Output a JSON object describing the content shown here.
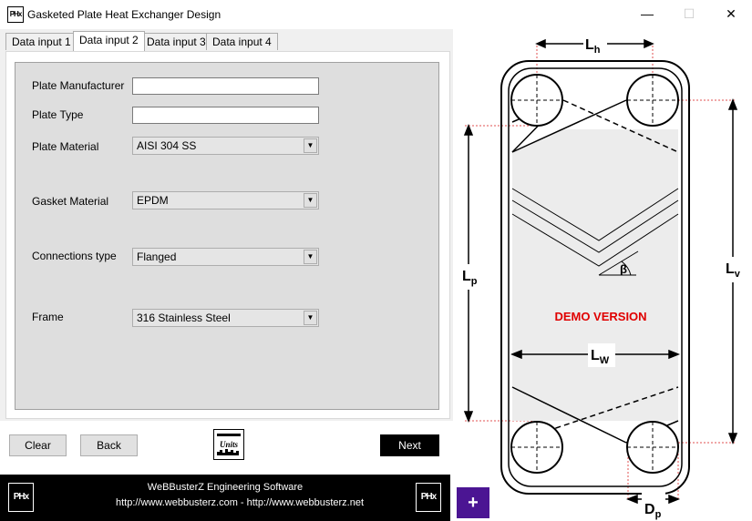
{
  "window": {
    "title": "Gasketed Plate Heat Exchanger Design",
    "app_icon_text": "PHx",
    "minimize_glyph": "—",
    "maximize_glyph": "☐",
    "close_glyph": "✕"
  },
  "tabs": [
    {
      "label": "Data input 1",
      "active": false
    },
    {
      "label": "Data input 2",
      "active": true
    },
    {
      "label": "Data input 3",
      "active": false
    },
    {
      "label": "Data input 4",
      "active": false
    }
  ],
  "form": {
    "plate_manufacturer": {
      "label": "Plate Manufacturer",
      "value": ""
    },
    "plate_type": {
      "label": "Plate Type",
      "value": ""
    },
    "plate_material": {
      "label": "Plate Material",
      "value": "AISI 304 SS"
    },
    "gasket_material": {
      "label": "Gasket Material",
      "value": "EPDM"
    },
    "connections_type": {
      "label": "Connections type",
      "value": "Flanged"
    },
    "frame": {
      "label": "Frame",
      "value": "316 Stainless Steel"
    }
  },
  "buttons": {
    "clear": "Clear",
    "back": "Back",
    "next": "Next",
    "units_icon": "units-icon",
    "plus": "+"
  },
  "footer": {
    "company": "WeBBusterZ Engineering Software",
    "urls": "http://www.webbusterz.com - http://www.webbusterz.net",
    "logo_text": "PHx"
  },
  "diagram": {
    "demo_text": "DEMO VERSION",
    "labels": {
      "lh": "L",
      "lh_sub": "h",
      "lv": "L",
      "lv_sub": "v",
      "lp": "L",
      "lp_sub": "p",
      "lw": "L",
      "lw_sub": "W",
      "dp": "D",
      "dp_sub": "p",
      "beta": "β"
    }
  },
  "colors": {
    "accent_purple": "#4b1593",
    "demo_red": "#e00000",
    "panel_gray": "#dedede"
  }
}
